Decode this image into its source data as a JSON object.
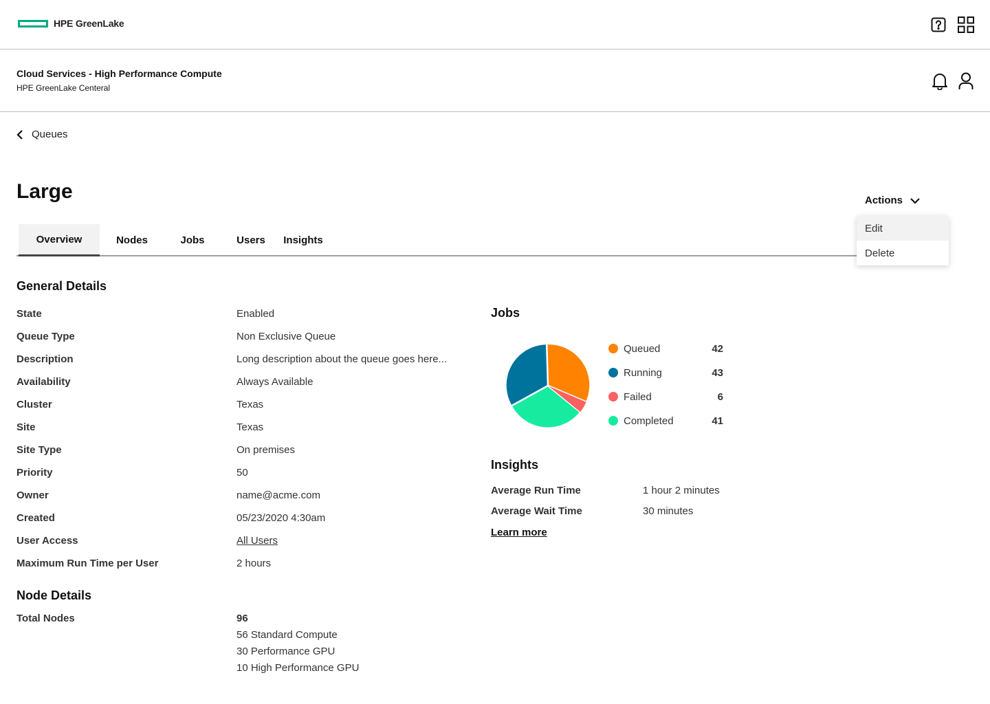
{
  "header": {
    "brand": "HPE GreenLake",
    "accent": "#01a982"
  },
  "service": {
    "title": "Cloud Services - High Performance Compute",
    "subtitle": "HPE GreenLake Centeral"
  },
  "breadcrumb": {
    "back_label": "Queues"
  },
  "page": {
    "title": "Large"
  },
  "tabs": [
    {
      "label": "Overview",
      "active": true
    },
    {
      "label": "Nodes"
    },
    {
      "label": "Jobs"
    },
    {
      "label": "Users"
    },
    {
      "label": "Insights"
    }
  ],
  "actions": {
    "label": "Actions",
    "menu": [
      "Edit",
      "Delete"
    ]
  },
  "general": {
    "heading": "General Details",
    "rows": [
      {
        "label": "State",
        "value": "Enabled"
      },
      {
        "label": "Queue Type",
        "value": "Non Exclusive Queue"
      },
      {
        "label": "Description",
        "value": "Long description about the queue goes here..."
      },
      {
        "label": "Availability",
        "value": "Always Available"
      },
      {
        "label": "Cluster",
        "value": "Texas"
      },
      {
        "label": "Site",
        "value": "Texas"
      },
      {
        "label": "Site Type",
        "value": "On premises"
      },
      {
        "label": "Priority",
        "value": "50"
      },
      {
        "label": "Owner",
        "value": "name@acme.com"
      },
      {
        "label": "Created",
        "value": "05/23/2020 4:30am"
      },
      {
        "label": "User Access",
        "value": "All Users"
      },
      {
        "label": "Maximum Run Time per User",
        "value": "2 hours"
      }
    ]
  },
  "nodes": {
    "heading": "Node Details",
    "label": "Total Nodes",
    "total": "96",
    "breakdown": [
      "56 Standard Compute",
      "30 Performance GPU",
      "10 High Performance GPU"
    ]
  },
  "jobs": {
    "heading": "Jobs",
    "legend": [
      {
        "label": "Queued",
        "count": "42",
        "color": "#ff8300"
      },
      {
        "label": "Running",
        "count": "43",
        "color": "#00739d"
      },
      {
        "label": "Failed",
        "count": "6",
        "color": "#fc6161"
      },
      {
        "label": "Completed",
        "count": "41",
        "color": "#17eba0"
      }
    ]
  },
  "chart_data": {
    "type": "pie",
    "categories": [
      "Queued",
      "Failed",
      "Completed",
      "Running"
    ],
    "values": [
      42,
      6,
      41,
      43
    ],
    "colors": [
      "#ff8300",
      "#fc6161",
      "#17eba0",
      "#00739d"
    ]
  },
  "insights": {
    "heading": "Insights",
    "rows": [
      {
        "label": "Average Run Time",
        "value": "1 hour 2 minutes"
      },
      {
        "label": "Average Wait Time",
        "value": "30 minutes"
      }
    ],
    "link": "Learn more"
  }
}
